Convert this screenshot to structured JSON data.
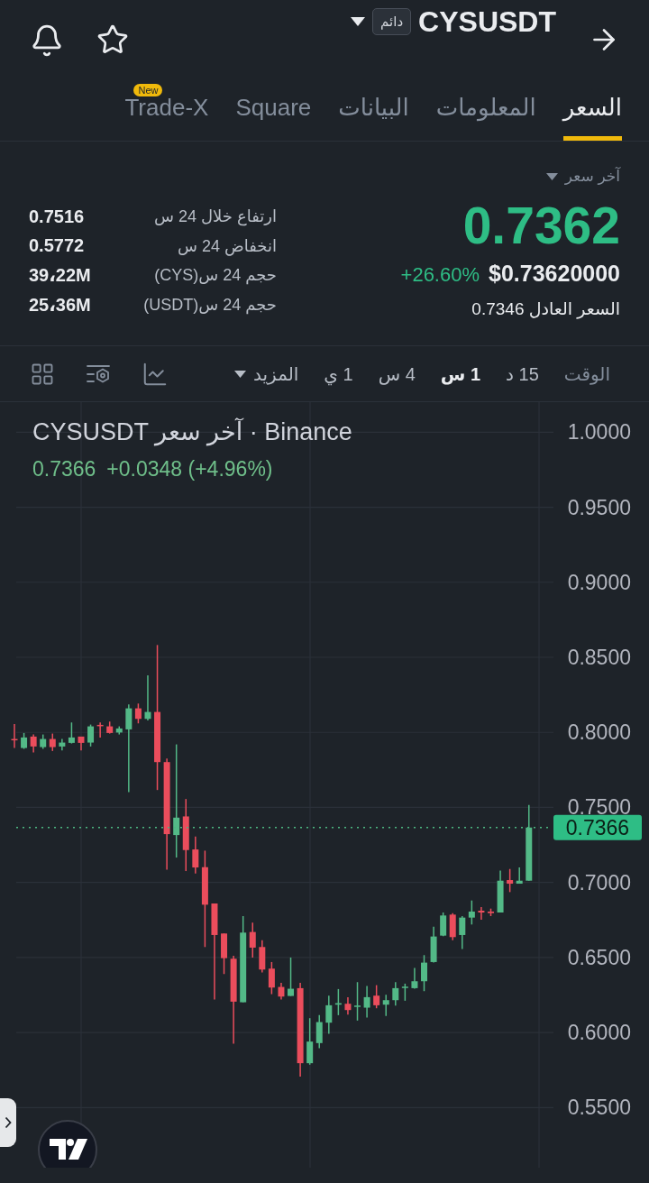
{
  "header": {
    "symbol": "CYSUSDT",
    "contract_badge": "دائم"
  },
  "tabs": [
    {
      "label": "السعر",
      "selected": true
    },
    {
      "label": "المعلومات",
      "selected": false
    },
    {
      "label": "البيانات",
      "selected": false
    },
    {
      "label": "Square",
      "selected": false
    },
    {
      "label": "Trade-X",
      "selected": false,
      "badge": "New"
    }
  ],
  "price_panel": {
    "price_type": "آخر سعر",
    "last_price": "0.7362",
    "usd_price": "$0.73620000",
    "change": "+26.60%",
    "fair_price": "السعر العادل 0.7346"
  },
  "stats": [
    {
      "label": "ارتفاع خلال 24 س",
      "value": "0.7516"
    },
    {
      "label": "انخفاض 24 س",
      "value": "0.5772"
    },
    {
      "label": "حجم 24 س(CYS)",
      "value": "39،22M"
    },
    {
      "label": "حجم 24 س(USDT)",
      "value": "25،36M"
    }
  ],
  "interval_bar": {
    "label": "الوقت",
    "intervals": [
      {
        "label": "15 د",
        "selected": false
      },
      {
        "label": "1 س",
        "selected": true
      },
      {
        "label": "4 س",
        "selected": false
      },
      {
        "label": "1 ي",
        "selected": false
      }
    ],
    "more": "المزيد"
  },
  "chart": {
    "legend_title": "CYSUSDT آخر سعر · Binance",
    "legend_price": "0.7366",
    "legend_change": "+0.0348 (+4.96%)",
    "chart_data": {
      "type": "candlestick",
      "ylim": [
        0.51,
        1.02
      ],
      "grid": true,
      "yticks": [
        {
          "value": 1.0,
          "label": "1.0000"
        },
        {
          "value": 0.95,
          "label": "0.9500"
        },
        {
          "value": 0.9,
          "label": "0.9000"
        },
        {
          "value": 0.85,
          "label": "0.8500"
        },
        {
          "value": 0.8,
          "label": "0.8000"
        },
        {
          "value": 0.75,
          "label": "0.7500"
        },
        {
          "value": 0.7,
          "label": "0.7000"
        },
        {
          "value": 0.65,
          "label": "0.6500"
        },
        {
          "value": 0.6,
          "label": "0.6000"
        },
        {
          "value": 0.55,
          "label": "0.5500"
        }
      ],
      "ohlc": [
        [
          0.7956,
          0.8056,
          0.7896,
          0.795
        ],
        [
          0.7896,
          0.7996,
          0.789,
          0.7966
        ],
        [
          0.7972,
          0.7986,
          0.7866,
          0.7906
        ],
        [
          0.7902,
          0.7986,
          0.789,
          0.7956
        ],
        [
          0.7956,
          0.7992,
          0.7876,
          0.7902
        ],
        [
          0.7906,
          0.7956,
          0.788,
          0.7932
        ],
        [
          0.793,
          0.8066,
          0.7926,
          0.7966
        ],
        [
          0.7972,
          0.7972,
          0.788,
          0.793
        ],
        [
          0.7932,
          0.8052,
          0.7906,
          0.804
        ],
        [
          0.805,
          0.8066,
          0.7966,
          0.8044
        ],
        [
          0.804,
          0.8072,
          0.7992,
          0.7996
        ],
        [
          0.7999,
          0.804,
          0.7986,
          0.8026
        ],
        [
          0.802,
          0.8186,
          0.7602,
          0.816
        ],
        [
          0.816,
          0.8192,
          0.806,
          0.809
        ],
        [
          0.809,
          0.838,
          0.808,
          0.8136
        ],
        [
          0.8136,
          0.8582,
          0.7616,
          0.7802
        ],
        [
          0.7802,
          0.7826,
          0.7086,
          0.7322
        ],
        [
          0.7316,
          0.792,
          0.7166,
          0.7432
        ],
        [
          0.744,
          0.7556,
          0.7076,
          0.7216
        ],
        [
          0.722,
          0.7306,
          0.706,
          0.71
        ],
        [
          0.7102,
          0.7212,
          0.657,
          0.6852
        ],
        [
          0.686,
          0.686,
          0.622,
          0.665
        ],
        [
          0.666,
          0.666,
          0.639,
          0.6496
        ],
        [
          0.6492,
          0.6512,
          0.5926,
          0.6206
        ],
        [
          0.6202,
          0.6776,
          0.6202,
          0.6666
        ],
        [
          0.667,
          0.6732,
          0.65,
          0.6566
        ],
        [
          0.657,
          0.6616,
          0.64,
          0.642
        ],
        [
          0.6426,
          0.647,
          0.6256,
          0.63
        ],
        [
          0.6304,
          0.6332,
          0.622,
          0.624
        ],
        [
          0.6244,
          0.65,
          0.6244,
          0.6292
        ],
        [
          0.6296,
          0.6332,
          0.5706,
          0.5796
        ],
        [
          0.5796,
          0.6096,
          0.5786,
          0.594
        ],
        [
          0.593,
          0.6116,
          0.5896,
          0.607
        ],
        [
          0.6066,
          0.6246,
          0.5992,
          0.6182
        ],
        [
          0.6186,
          0.629,
          0.6116,
          0.6196
        ],
        [
          0.6192,
          0.6236,
          0.612,
          0.615
        ],
        [
          0.6172,
          0.6336,
          0.608,
          0.618
        ],
        [
          0.6166,
          0.631,
          0.61,
          0.6236
        ],
        [
          0.6246,
          0.6316,
          0.6162,
          0.6182
        ],
        [
          0.6186,
          0.6252,
          0.611,
          0.6216
        ],
        [
          0.6216,
          0.6336,
          0.618,
          0.6296
        ],
        [
          0.6298,
          0.6326,
          0.6212,
          0.6306
        ],
        [
          0.6296,
          0.643,
          0.6292,
          0.6342
        ],
        [
          0.6342,
          0.6516,
          0.6276,
          0.6466
        ],
        [
          0.647,
          0.6706,
          0.6466,
          0.664
        ],
        [
          0.6646,
          0.68,
          0.6642,
          0.678
        ],
        [
          0.6786,
          0.6796,
          0.6616,
          0.6636
        ],
        [
          0.665,
          0.6776,
          0.6556,
          0.6766
        ],
        [
          0.6766,
          0.688,
          0.672,
          0.6806
        ],
        [
          0.6812,
          0.6836,
          0.6752,
          0.68
        ],
        [
          0.6806,
          0.6826,
          0.6776,
          0.6796
        ],
        [
          0.68,
          0.708,
          0.68,
          0.7012
        ],
        [
          0.7016,
          0.709,
          0.6936,
          0.6992
        ],
        [
          0.6992,
          0.71,
          0.6992,
          0.7012
        ],
        [
          0.7012,
          0.7516,
          0.7012,
          0.7366
        ]
      ],
      "ref_lines": [
        {
          "axis": "y",
          "value": 0.7366,
          "label": "0.7366"
        }
      ]
    }
  }
}
